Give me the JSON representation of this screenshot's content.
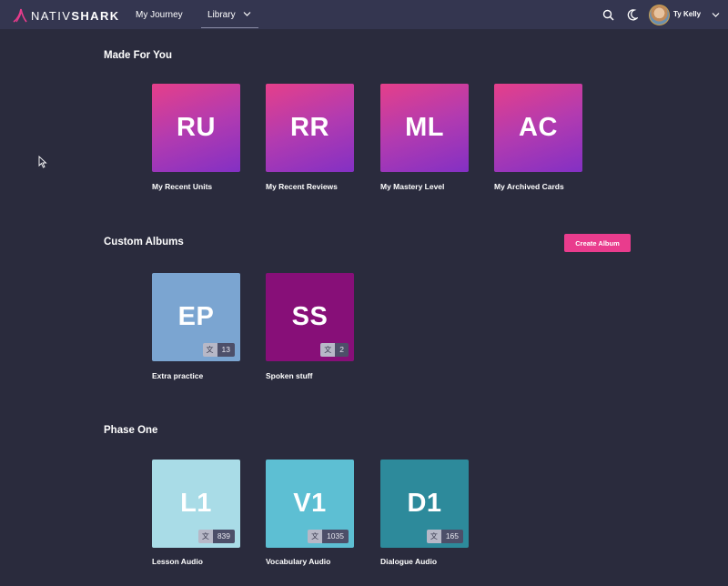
{
  "header": {
    "logo": {
      "prefix": "NATIV",
      "suffix": "SHARK",
      "icon": "shark-fin-icon"
    },
    "nav": [
      {
        "label": "My Journey"
      },
      {
        "label": "Library"
      }
    ],
    "icons": [
      "search-icon",
      "moon-icon",
      "chevron-down-icon"
    ],
    "user": {
      "name": "Ty Kelly"
    }
  },
  "sections": {
    "made_for_you": {
      "title": "Made For You",
      "items": [
        {
          "initials": "RU",
          "label": "My Recent Units"
        },
        {
          "initials": "RR",
          "label": "My Recent Reviews"
        },
        {
          "initials": "ML",
          "label": "My Mastery Level"
        },
        {
          "initials": "AC",
          "label": "My Archived Cards"
        }
      ]
    },
    "custom_albums": {
      "title": "Custom Albums",
      "create_label": "Create Album",
      "items": [
        {
          "initials": "EP",
          "label": "Extra practice",
          "count": "13",
          "color": "#7ba5d1"
        },
        {
          "initials": "SS",
          "label": "Spoken stuff",
          "count": "2",
          "color": "#870f78"
        }
      ]
    },
    "phase_one": {
      "title": "Phase One",
      "items": [
        {
          "initials": "L1",
          "label": "Lesson Audio",
          "count": "839",
          "color": "#a9dce7"
        },
        {
          "initials": "V1",
          "label": "Vocabulary Audio",
          "count": "1035",
          "color": "#5dbfd3"
        },
        {
          "initials": "D1",
          "label": "Dialogue Audio",
          "count": "165",
          "color": "#2d8a9b"
        }
      ]
    }
  },
  "badge_glyph": "文",
  "colors": {
    "background": "#2a2b3d",
    "topbar": "#343650",
    "accent": "#e93c8d"
  }
}
